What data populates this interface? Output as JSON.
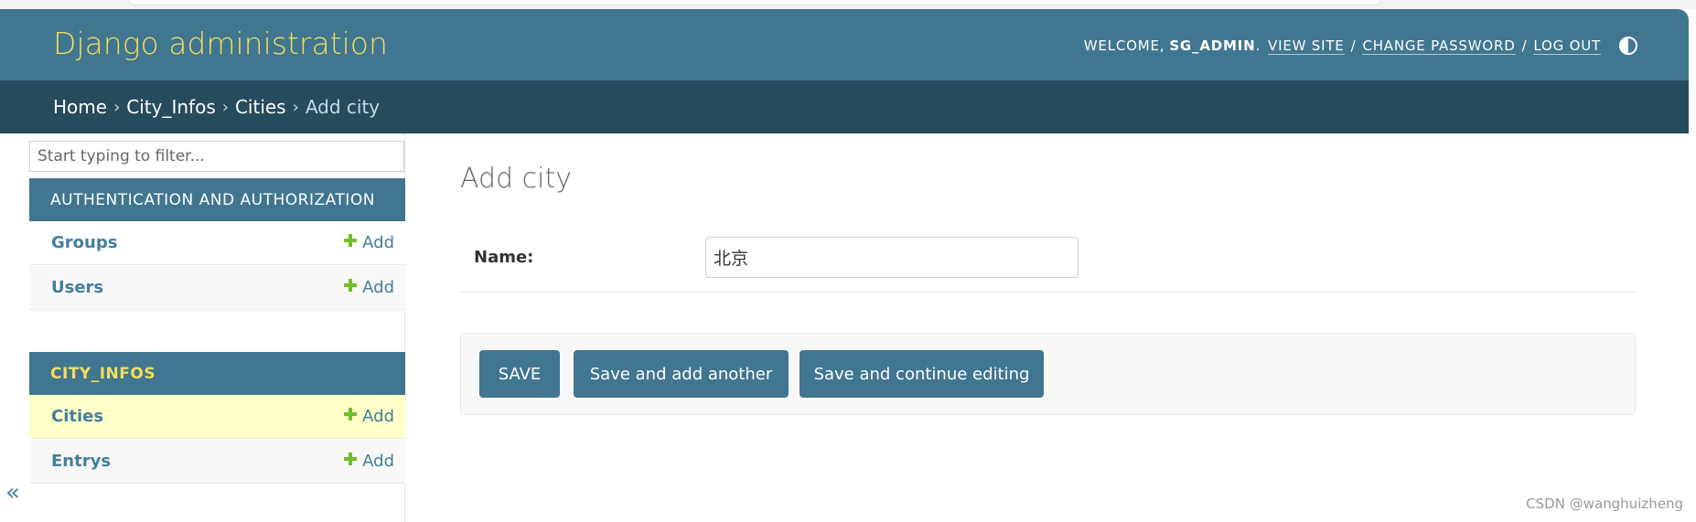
{
  "header": {
    "branding": "Django administration",
    "welcome": "WELCOME,",
    "username": "SG_ADMIN",
    "view_site": "VIEW SITE",
    "change_password": "CHANGE PASSWORD",
    "log_out": "LOG OUT",
    "separator": "/",
    "theme_icon": "half-circle-icon"
  },
  "breadcrumbs": {
    "home": "Home",
    "app": "City_Infos",
    "model": "Cities",
    "current": "Add city",
    "separator": "›"
  },
  "sidebar": {
    "filter_placeholder": "Start typing to filter...",
    "modules": [
      {
        "caption": "AUTHENTICATION AND AUTHORIZATION",
        "models": [
          {
            "name": "Groups",
            "add": "Add"
          },
          {
            "name": "Users",
            "add": "Add"
          }
        ]
      },
      {
        "caption": "CITY_INFOS",
        "models": [
          {
            "name": "Cities",
            "add": "Add"
          },
          {
            "name": "Entrys",
            "add": "Add"
          }
        ]
      }
    ],
    "collapse_glyph": "«"
  },
  "content": {
    "title": "Add city",
    "fields": [
      {
        "label": "Name:",
        "value": "北京"
      }
    ],
    "buttons": {
      "save": "SAVE",
      "save_add_another": "Save and add another",
      "save_continue": "Save and continue editing"
    }
  },
  "watermark": "CSDN @wanghuizheng",
  "colors": {
    "header_bg": "#417690",
    "breadcrumb_bg": "#264b5d",
    "branding": "#f5dd5d",
    "link": "#447e9b",
    "add_icon": "#70bf2b",
    "current_row": "#ffffc8"
  }
}
